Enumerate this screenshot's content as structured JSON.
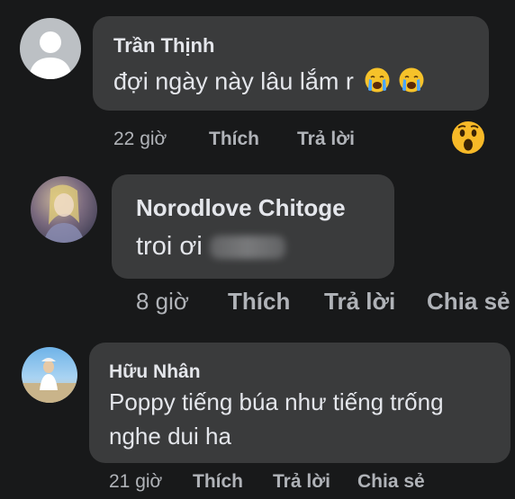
{
  "comments": [
    {
      "author": "Trần Thịnh",
      "text": "đợi ngày này lâu lắm r",
      "emoji": [
        "crying-face",
        "crying-face"
      ],
      "time": "22 giờ",
      "like_label": "Thích",
      "reply_label": "Trả lời",
      "reaction": "wow-reaction"
    },
    {
      "author": "Norodlove Chitoge",
      "text": "troi ơi",
      "time": "8 giờ",
      "like_label": "Thích",
      "reply_label": "Trả lời",
      "share_label": "Chia sẻ"
    },
    {
      "author": "Hữu Nhân",
      "text_line1": "Poppy tiếng búa như tiếng trống",
      "text_line2": "nghe dui ha",
      "time": "21 giờ",
      "like_label": "Thích",
      "reply_label": "Trả lời",
      "share_label": "Chia sẻ"
    }
  ],
  "colors": {
    "background": "#18191a",
    "bubble": "#3a3b3c",
    "primary_text": "#e4e6eb",
    "secondary_text": "#b0b3b8"
  }
}
